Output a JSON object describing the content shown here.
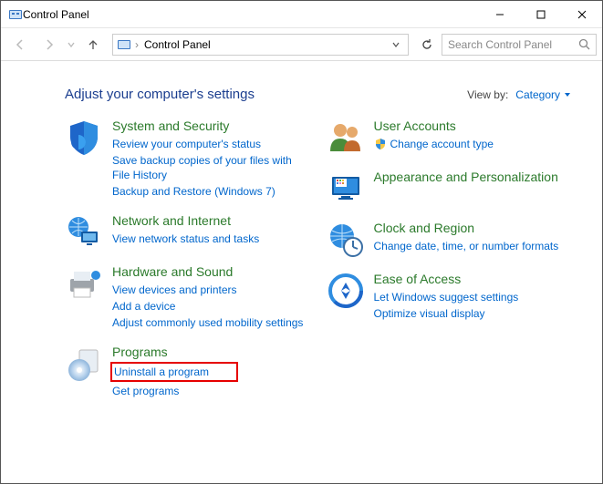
{
  "window": {
    "title": "Control Panel"
  },
  "toolbar": {
    "breadcrumb": "Control Panel",
    "search_placeholder": "Search Control Panel"
  },
  "heading": "Adjust your computer's settings",
  "viewby": {
    "label": "View by:",
    "value": "Category"
  },
  "left": [
    {
      "title": "System and Security",
      "subs": [
        "Review your computer's status",
        "Save backup copies of your files with File History",
        "Backup and Restore (Windows 7)"
      ]
    },
    {
      "title": "Network and Internet",
      "subs": [
        "View network status and tasks"
      ]
    },
    {
      "title": "Hardware and Sound",
      "subs": [
        "View devices and printers",
        "Add a device",
        "Adjust commonly used mobility settings"
      ]
    },
    {
      "title": "Programs",
      "subs": [
        "Uninstall a program",
        "Get programs"
      ]
    }
  ],
  "right": [
    {
      "title": "User Accounts",
      "subs": [
        "Change account type"
      ],
      "sub_icon": "shield"
    },
    {
      "title": "Appearance and Personalization",
      "subs": []
    },
    {
      "title": "Clock and Region",
      "subs": [
        "Change date, time, or number formats"
      ]
    },
    {
      "title": "Ease of Access",
      "subs": [
        "Let Windows suggest settings",
        "Optimize visual display"
      ]
    }
  ]
}
